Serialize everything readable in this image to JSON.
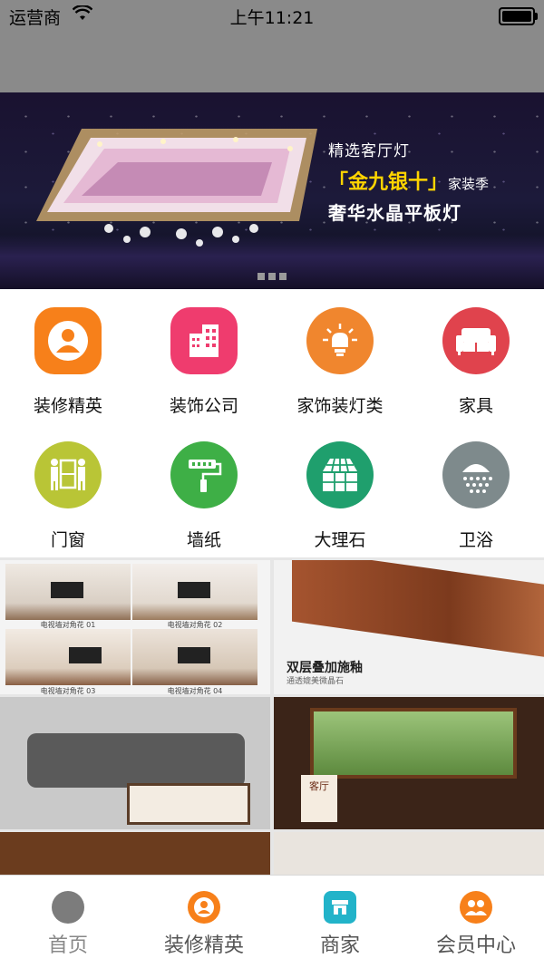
{
  "status_bar": {
    "carrier": "运营商",
    "time": "上午11:21"
  },
  "banner": {
    "line1": "精选客厅灯",
    "line2_bracketed": "「金九银十」",
    "line2_suffix": "家装季",
    "line3": "奢华水晶平板灯"
  },
  "categories": [
    {
      "label": "装修精英",
      "icon": "person-icon",
      "color": "#f7801a"
    },
    {
      "label": "装饰公司",
      "icon": "building-icon",
      "color": "#ef3c6e"
    },
    {
      "label": "家饰装灯类",
      "icon": "lightbulb-icon",
      "color": "#f0862e"
    },
    {
      "label": "家具",
      "icon": "sofa-icon",
      "color": "#e0434d"
    },
    {
      "label": "门窗",
      "icon": "door-movers-icon",
      "color": "#b9c536"
    },
    {
      "label": "墙纸",
      "icon": "paint-roller-icon",
      "color": "#3eaf46"
    },
    {
      "label": "大理石",
      "icon": "tiles-icon",
      "color": "#1f9f6d"
    },
    {
      "label": "卫浴",
      "icon": "shower-icon",
      "color": "#7e8a8c"
    }
  ],
  "tiles": {
    "tv_walls": [
      "电视墙对角花 01",
      "电视墙对角花 02",
      "电视墙对角花 03",
      "电视墙对角花 04"
    ],
    "floor_caption": "双层叠加施釉",
    "floor_subcaption": "通透媲美微晶石",
    "window_tag": "客厅"
  },
  "tab_bar": [
    {
      "label": "首页",
      "icon": "home-icon",
      "color": "#7c7c7c"
    },
    {
      "label": "装修精英",
      "icon": "person-icon",
      "color": "#f7801a"
    },
    {
      "label": "商家",
      "icon": "store-icon",
      "color": "#22b3c9"
    },
    {
      "label": "会员中心",
      "icon": "members-icon",
      "color": "#f7801a"
    }
  ]
}
